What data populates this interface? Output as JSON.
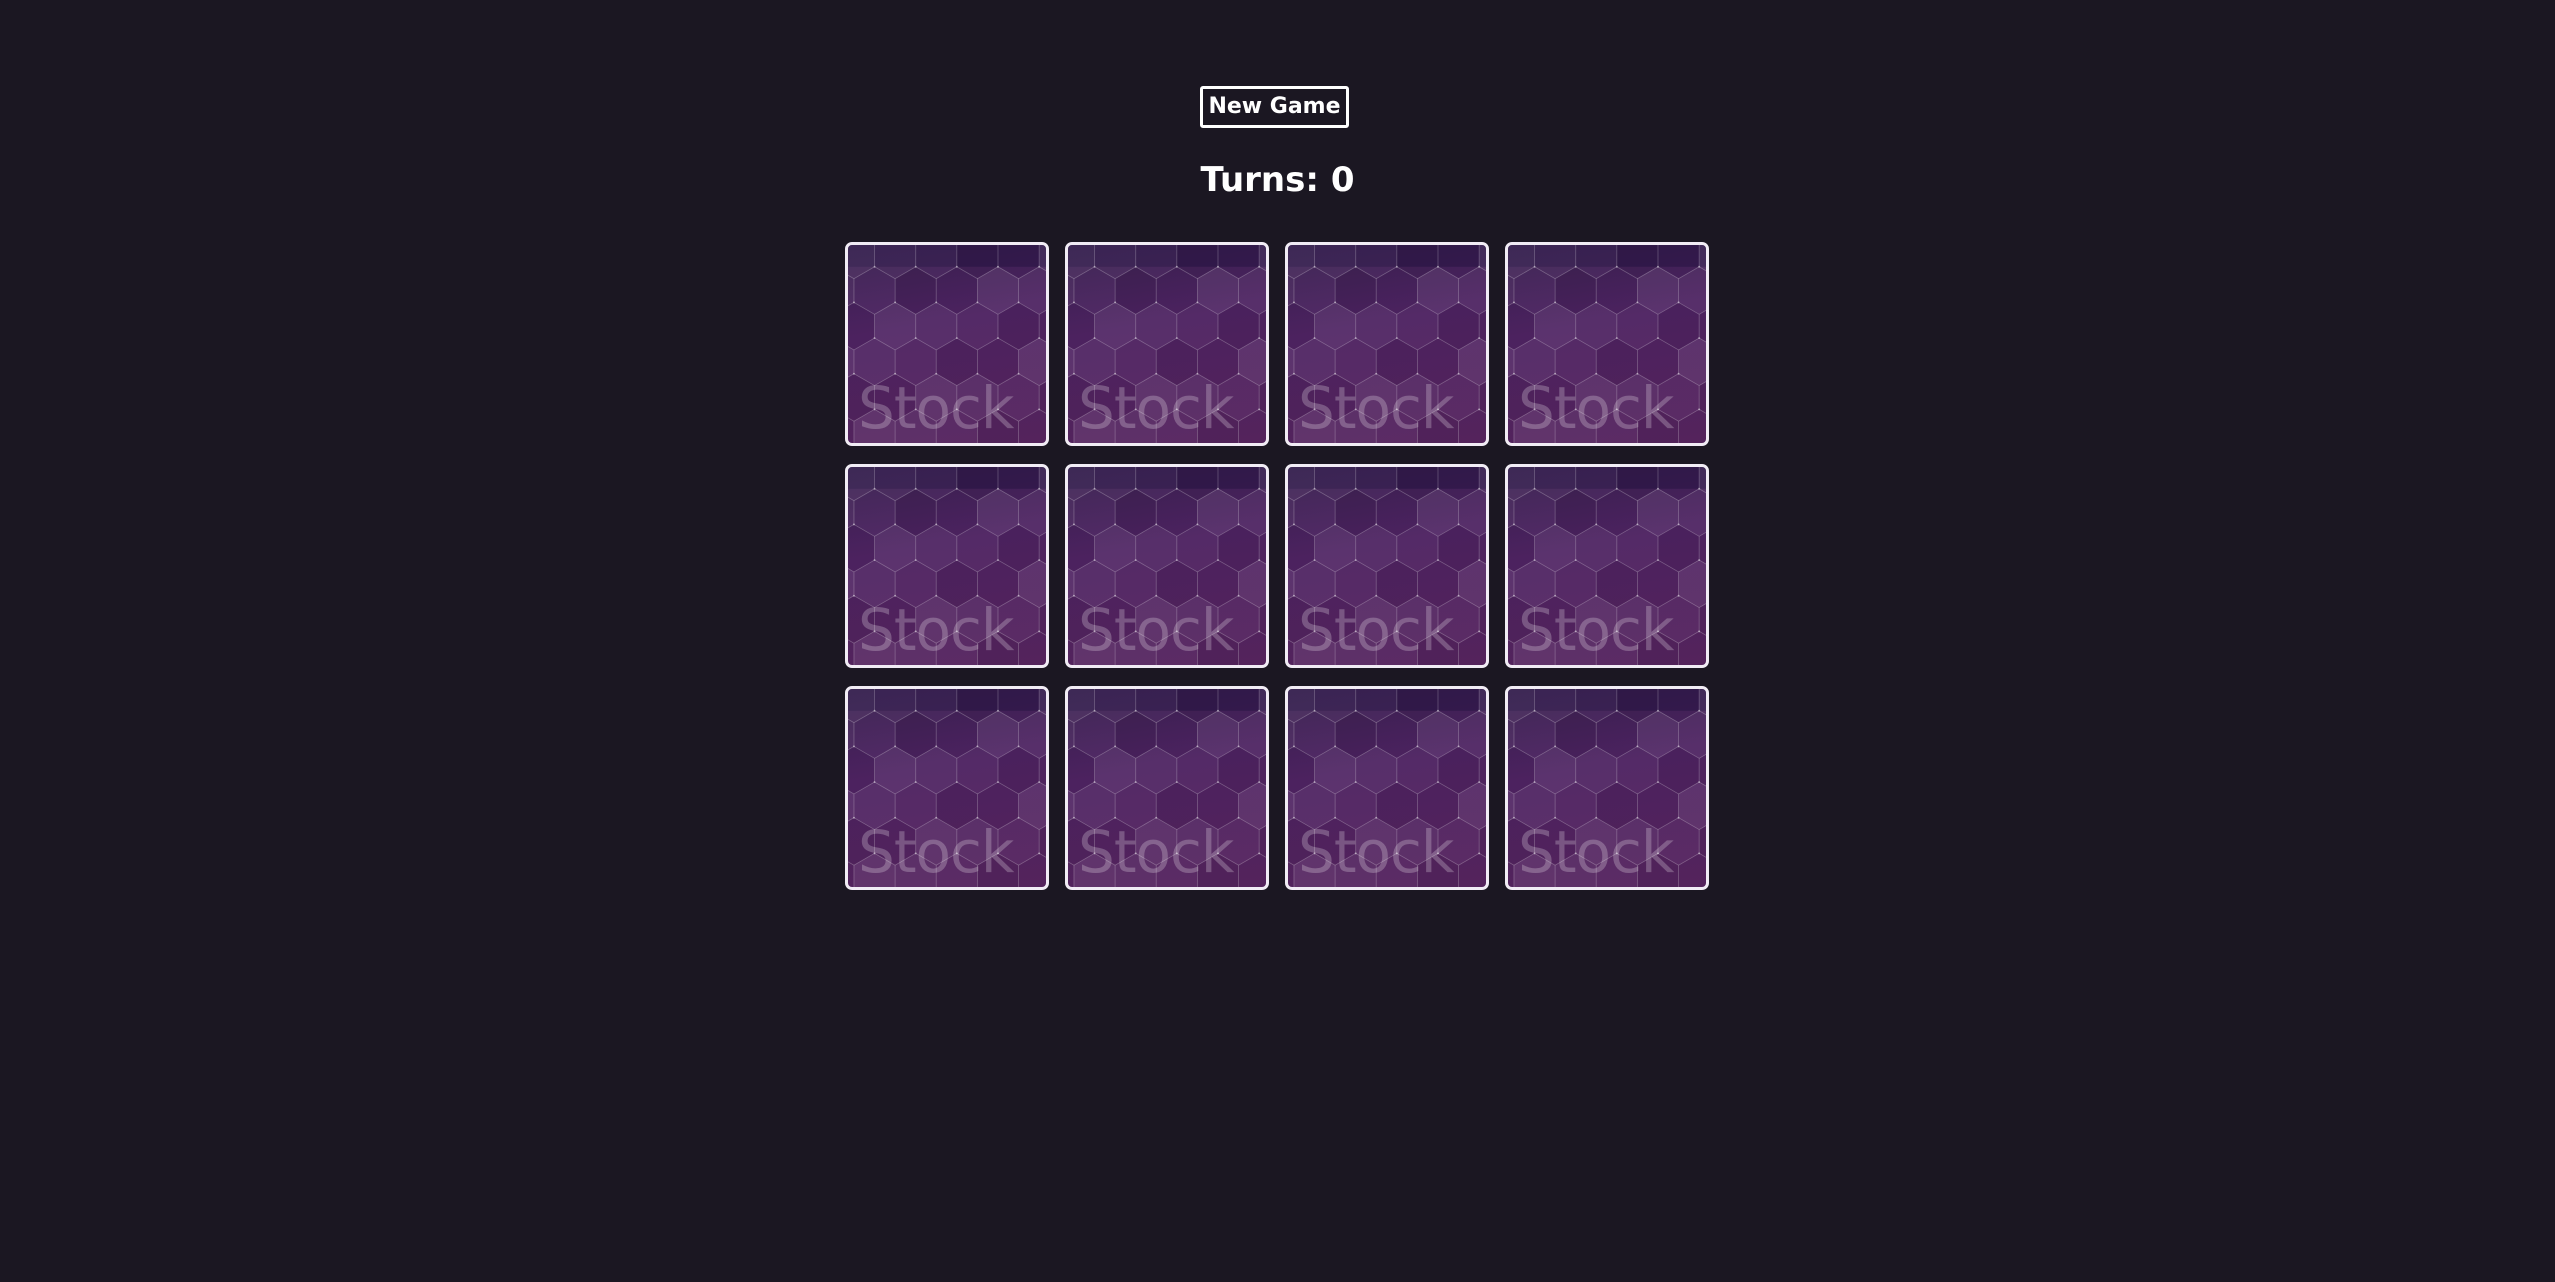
{
  "controls": {
    "new_game_label": "New Game"
  },
  "status": {
    "turns_label": "Turns: ",
    "turns_count": "0"
  },
  "board": {
    "rows": 3,
    "columns": 4,
    "card_back_watermark": "Stock",
    "cards": [
      {
        "state": "face-down"
      },
      {
        "state": "face-down"
      },
      {
        "state": "face-down"
      },
      {
        "state": "face-down"
      },
      {
        "state": "face-down"
      },
      {
        "state": "face-down"
      },
      {
        "state": "face-down"
      },
      {
        "state": "face-down"
      },
      {
        "state": "face-down"
      },
      {
        "state": "face-down"
      },
      {
        "state": "face-down"
      },
      {
        "state": "face-down"
      }
    ]
  },
  "colors": {
    "background": "#1b1722",
    "card_back": "#4f2463",
    "card_border": "#f1ecf5",
    "text": "#ffffff"
  }
}
